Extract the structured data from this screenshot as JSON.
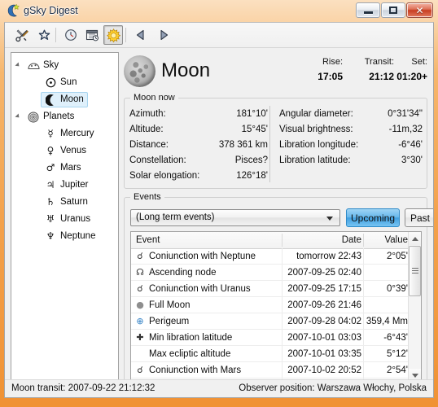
{
  "window": {
    "title": "gSky Digest",
    "icon": "moon-star-icon",
    "buttons": {
      "minimize": "minimize-button",
      "maximize": "maximize-button",
      "close": "✕"
    }
  },
  "toolbar": {
    "items": [
      {
        "name": "tools-icon",
        "glyph": "⚒",
        "pressed": false
      },
      {
        "name": "favorites-star-icon",
        "glyph": "☆",
        "pressed": false
      },
      {
        "name": "clock-icon",
        "glyph": "◷",
        "pressed": false
      },
      {
        "name": "calendar-icon",
        "glyph": "☷",
        "pressed": false
      },
      {
        "name": "sun-icon",
        "glyph": "☀",
        "pressed": true
      },
      {
        "name": "previous-icon",
        "glyph": "◀",
        "pressed": false
      },
      {
        "name": "next-icon",
        "glyph": "▶",
        "pressed": false
      }
    ]
  },
  "tree": {
    "nodes": [
      {
        "label": "Sky",
        "icon": "☁",
        "level": 1,
        "expander": true,
        "selected": false
      },
      {
        "label": "Sun",
        "icon": "☉",
        "level": 2,
        "expander": false,
        "selected": false
      },
      {
        "label": "Moon",
        "icon": "☾",
        "level": 2,
        "expander": false,
        "selected": true
      },
      {
        "label": "Planets",
        "icon": "◎",
        "level": 1,
        "expander": true,
        "selected": false
      },
      {
        "label": "Mercury",
        "icon": "☿",
        "level": 2,
        "expander": false,
        "selected": false
      },
      {
        "label": "Venus",
        "icon": "♀",
        "level": 2,
        "expander": false,
        "selected": false
      },
      {
        "label": "Mars",
        "icon": "♂",
        "level": 2,
        "expander": false,
        "selected": false
      },
      {
        "label": "Jupiter",
        "icon": "♃",
        "level": 2,
        "expander": false,
        "selected": false
      },
      {
        "label": "Saturn",
        "icon": "♄",
        "level": 2,
        "expander": false,
        "selected": false
      },
      {
        "label": "Uranus",
        "icon": "♅",
        "level": 2,
        "expander": false,
        "selected": false
      },
      {
        "label": "Neptune",
        "icon": "♆",
        "level": 2,
        "expander": false,
        "selected": false
      }
    ]
  },
  "object": {
    "name": "Moon",
    "image": "moon-thumbnail",
    "rise": {
      "label": "Rise:",
      "value": "17:05"
    },
    "transit": {
      "label": "Transit:",
      "value": "21:12"
    },
    "set": {
      "label": "Set:",
      "value": "01:20+"
    }
  },
  "now": {
    "legend": "Moon now",
    "left": [
      {
        "key": "Azimuth:",
        "value": "181°10'"
      },
      {
        "key": "Altitude:",
        "value": "15°45'"
      },
      {
        "key": "Distance:",
        "value": "378 361 km"
      },
      {
        "key": "Constellation:",
        "value": "Pisces?"
      },
      {
        "key": "Solar elongation:",
        "value": "126°18'"
      }
    ],
    "right": [
      {
        "key": "Angular diameter:",
        "value": "0°31'34\""
      },
      {
        "key": "Visual brightness:",
        "value": "-11m,32"
      },
      {
        "key": "Libration longitude:",
        "value": "-6°46'"
      },
      {
        "key": "Libration latitude:",
        "value": "3°30'"
      }
    ]
  },
  "events": {
    "legend": "Events",
    "filter": {
      "value": "(Long term events)",
      "placeholder": "(Long term events)"
    },
    "upcoming_label": "Upcoming",
    "past_label": "Past",
    "columns": [
      "Event",
      "Date",
      "Value"
    ],
    "rows": [
      {
        "icon": "☌",
        "event": "Coniunction with Neptune",
        "date": "tomorrow 22:43",
        "value": "2°05'"
      },
      {
        "icon": "☊",
        "event": "Ascending node",
        "date": "2007-09-25 02:40",
        "value": ""
      },
      {
        "icon": "☌",
        "event": "Coniunction with Uranus",
        "date": "2007-09-25 17:15",
        "value": "0°39'"
      },
      {
        "icon": "●",
        "event": "Full Moon",
        "date": "2007-09-26 21:46",
        "value": ""
      },
      {
        "icon": "⊕",
        "event": "Perigeum",
        "date": "2007-09-28 04:02",
        "value": "359,4 Mm"
      },
      {
        "icon": "✚",
        "event": "Min libration latitude",
        "date": "2007-10-01 03:03",
        "value": "-6°43'"
      },
      {
        "icon": "",
        "event": "Max ecliptic altitude",
        "date": "2007-10-01 03:35",
        "value": "5°12'"
      },
      {
        "icon": "☌",
        "event": "Coniunction with Mars",
        "date": "2007-10-02 20:52",
        "value": "2°54'"
      }
    ]
  },
  "status": {
    "left": "Moon transit: 2007-09-22 21:12:32",
    "right": "Observer position: Warszawa Włochy, Polska"
  }
}
